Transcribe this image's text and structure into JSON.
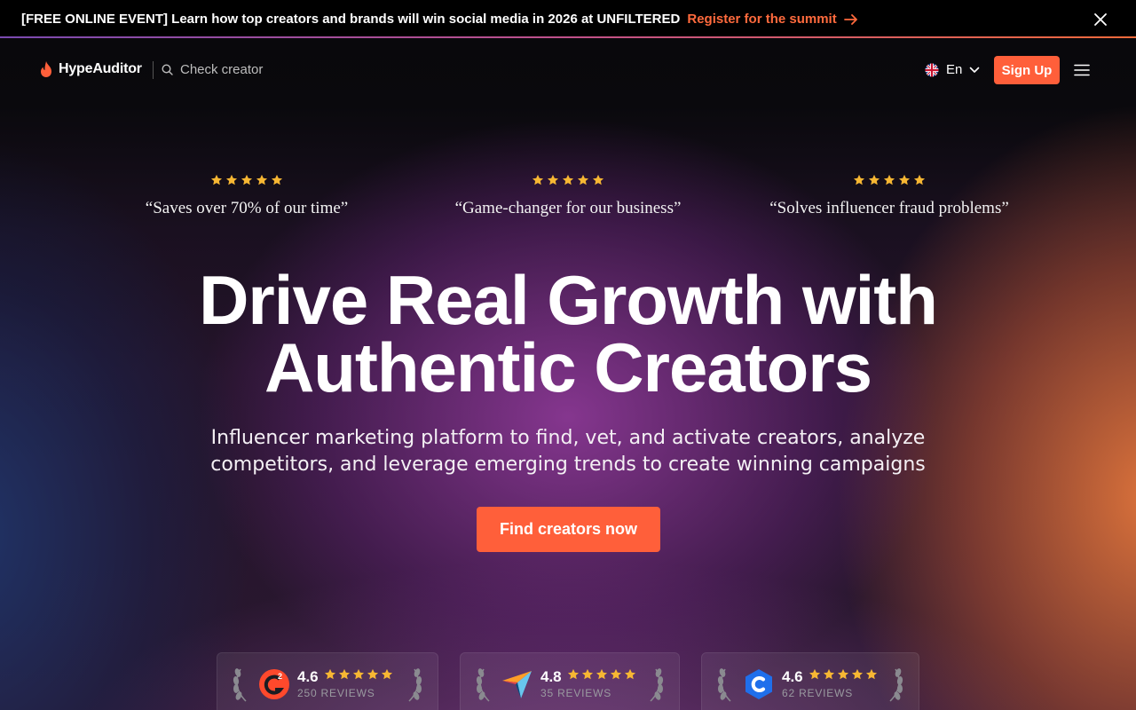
{
  "announcement": {
    "message": "[FREE ONLINE EVENT] Learn how top creators and brands will win social media in 2026 at UNFILTERED",
    "link_label": "Register for the summit"
  },
  "header": {
    "brand": "HypeAuditor",
    "search_placeholder": "Check creator",
    "language": "En",
    "signup_label": "Sign Up"
  },
  "testimonials": [
    {
      "stars": 5,
      "quote": "“Saves over 70% of our time”"
    },
    {
      "stars": 5,
      "quote": "“Game-changer for our business”"
    },
    {
      "stars": 5,
      "quote": "“Solves influencer fraud problems”"
    }
  ],
  "hero": {
    "title_line1": "Drive Real Growth with",
    "title_line2": "Authentic Creators",
    "subtitle_line1": "Influencer marketing platform to find, vet, and activate creators, analyze",
    "subtitle_line2": "competitors, and leverage emerging trends to create winning campaigns",
    "cta_label": "Find creators now"
  },
  "ratings": [
    {
      "platform_icon": "g2-logo-icon",
      "score": "4.6",
      "reviews": "250 REVIEWS"
    },
    {
      "platform_icon": "capterra-logo-icon",
      "score": "4.8",
      "reviews": "35 REVIEWS"
    },
    {
      "platform_icon": "crozdesk-logo-icon",
      "score": "4.6",
      "reviews": "62 REVIEWS"
    }
  ],
  "colors": {
    "accent": "#ff5f3a",
    "star": "#f7b733",
    "announcement_bg": "#000000"
  }
}
